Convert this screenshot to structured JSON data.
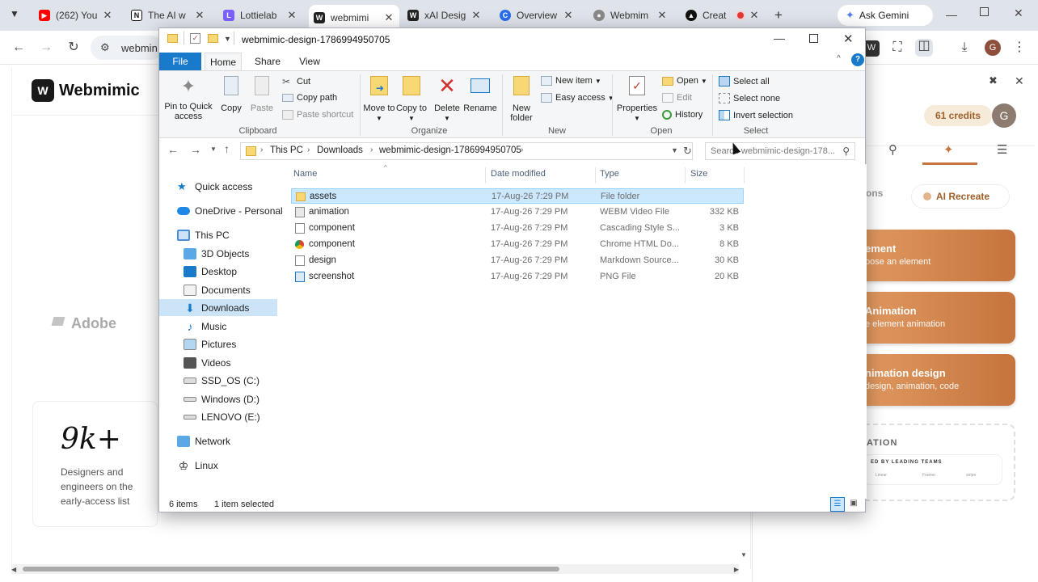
{
  "browser": {
    "tabs": [
      {
        "title": "(262) You",
        "icon": "youtube-icon",
        "color": "#ff0000"
      },
      {
        "title": "The AI w",
        "icon": "notion-icon",
        "color": "#111111"
      },
      {
        "title": "Lottielab",
        "icon": "lottielab-icon",
        "color": "#7b61ff"
      },
      {
        "title": "webmimi",
        "icon": "webmimic-icon",
        "color": "#222222"
      },
      {
        "title": "xAI Desig",
        "icon": "webmimic-icon",
        "color": "#222222"
      },
      {
        "title": "Overview",
        "icon": "overview-icon",
        "color": "#2b6de8"
      },
      {
        "title": "Webmim",
        "icon": "globe-icon",
        "color": "#666666"
      },
      {
        "title": "Creat",
        "icon": "create-icon",
        "color": "#111111"
      }
    ],
    "gemini_label": "Ask Gemini",
    "url_text": "webmin",
    "profile_initial": "G"
  },
  "page": {
    "logo_text": "Webmimic",
    "adobe_text": "Adobe",
    "stat_value": "9k+",
    "stat_caption": [
      "Designers and",
      "engineers on the",
      "early-access list"
    ],
    "credits": "61 credits",
    "avatar": "G",
    "tab_partial": "ons",
    "ai_recreate": "AI Recreate",
    "cards": [
      {
        "title": "ement",
        "sub": "oose an element"
      },
      {
        "title": "Animation",
        "sub": "e element animation"
      },
      {
        "title": "nimation design",
        "sub": "design, animation, code"
      }
    ],
    "section_label": "ATION",
    "trusted_label": "ED BY LEADING TEAMS",
    "logos_row": [
      "Linear",
      "Framer",
      "stripe"
    ]
  },
  "explorer": {
    "title": "webmimic-design-1786994950705",
    "ribbon_tabs": [
      "File",
      "Home",
      "Share",
      "View"
    ],
    "clipboard": {
      "pin": "Pin to Quick access",
      "copy": "Copy",
      "paste": "Paste",
      "cut": "Cut",
      "copy_path": "Copy path",
      "paste_shortcut": "Paste shortcut",
      "label": "Clipboard"
    },
    "organize": {
      "move_to": "Move to",
      "copy_to": "Copy to",
      "delete": "Delete",
      "rename": "Rename",
      "label": "Organize"
    },
    "new_group": {
      "new_folder": "New folder",
      "new_item": "New item",
      "easy_access": "Easy access",
      "label": "New"
    },
    "open_group": {
      "properties": "Properties",
      "open": "Open",
      "edit": "Edit",
      "history": "History",
      "label": "Open"
    },
    "select_group": {
      "select_all": "Select all",
      "select_none": "Select none",
      "invert": "Invert selection",
      "label": "Select"
    },
    "breadcrumb": [
      "This PC",
      "Downloads",
      "webmimic-design-1786994950705"
    ],
    "search_placeholder": "Search webmimic-design-178...",
    "columns": {
      "name": "Name",
      "date": "Date modified",
      "type": "Type",
      "size": "Size"
    },
    "nav": [
      {
        "label": "Quick access",
        "icon": "star-icon",
        "indent": 0
      },
      {
        "label": "OneDrive - Personal",
        "icon": "cloud-icon",
        "indent": 0
      },
      {
        "label": "This PC",
        "icon": "pc-icon",
        "indent": 0
      },
      {
        "label": "3D Objects",
        "icon": "cube-icon",
        "indent": 1
      },
      {
        "label": "Desktop",
        "icon": "desktop-icon",
        "indent": 1
      },
      {
        "label": "Documents",
        "icon": "documents-icon",
        "indent": 1
      },
      {
        "label": "Downloads",
        "icon": "download-icon",
        "indent": 1
      },
      {
        "label": "Music",
        "icon": "music-icon",
        "indent": 1
      },
      {
        "label": "Pictures",
        "icon": "pictures-icon",
        "indent": 1
      },
      {
        "label": "Videos",
        "icon": "videos-icon",
        "indent": 1
      },
      {
        "label": "SSD_OS (C:)",
        "icon": "drive-icon",
        "indent": 1
      },
      {
        "label": "Windows (D:)",
        "icon": "drive-icon",
        "indent": 1
      },
      {
        "label": "LENOVO (E:)",
        "icon": "drive-icon",
        "indent": 1
      },
      {
        "label": "Network",
        "icon": "network-icon",
        "indent": 0
      },
      {
        "label": "Linux",
        "icon": "linux-icon",
        "indent": 0
      }
    ],
    "files": [
      {
        "name": "assets",
        "date": "17-Aug-26 7:29 PM",
        "type": "File folder",
        "size": "",
        "icon": "folder-icon"
      },
      {
        "name": "animation",
        "date": "17-Aug-26 7:29 PM",
        "type": "WEBM Video File",
        "size": "332 KB",
        "icon": "video-file-icon"
      },
      {
        "name": "component",
        "date": "17-Aug-26 7:29 PM",
        "type": "Cascading Style S...",
        "size": "3 KB",
        "icon": "css-file-icon"
      },
      {
        "name": "component",
        "date": "17-Aug-26 7:29 PM",
        "type": "Chrome HTML Do...",
        "size": "8 KB",
        "icon": "chrome-file-icon"
      },
      {
        "name": "design",
        "date": "17-Aug-26 7:29 PM",
        "type": "Markdown Source...",
        "size": "30 KB",
        "icon": "markdown-file-icon"
      },
      {
        "name": "screenshot",
        "date": "17-Aug-26 7:29 PM",
        "type": "PNG File",
        "size": "20 KB",
        "icon": "image-file-icon"
      }
    ],
    "status_items": "6 items",
    "status_selected": "1 item selected"
  }
}
